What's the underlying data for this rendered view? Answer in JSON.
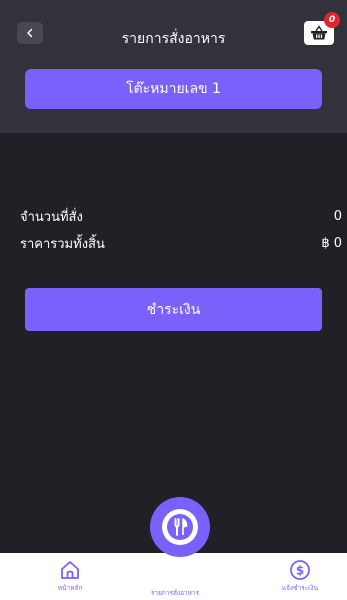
{
  "header": {
    "title": "รายการสั่งอาหาร",
    "back_icon": "chevron-left-icon",
    "cart_icon": "basket-icon",
    "cart_badge": "0"
  },
  "table_label": "โต๊ะหมายเลข 1",
  "summary": {
    "quantity_label": "จำนวนที่สั่ง",
    "quantity_value": "0",
    "total_label": "ราคารวมทั้งสิ้น",
    "total_value": "฿ 0"
  },
  "pay_button": "ชำระเงิน",
  "nav": {
    "home_label": "หน้าหลัก",
    "orders_label": "รายการสั่งอาหาร",
    "pay_label": "แจ้งชำระเงิน"
  },
  "colors": {
    "accent": "#7b61fb",
    "header_bg": "#32323c",
    "page_bg": "#202026",
    "badge": "#e0252c"
  }
}
